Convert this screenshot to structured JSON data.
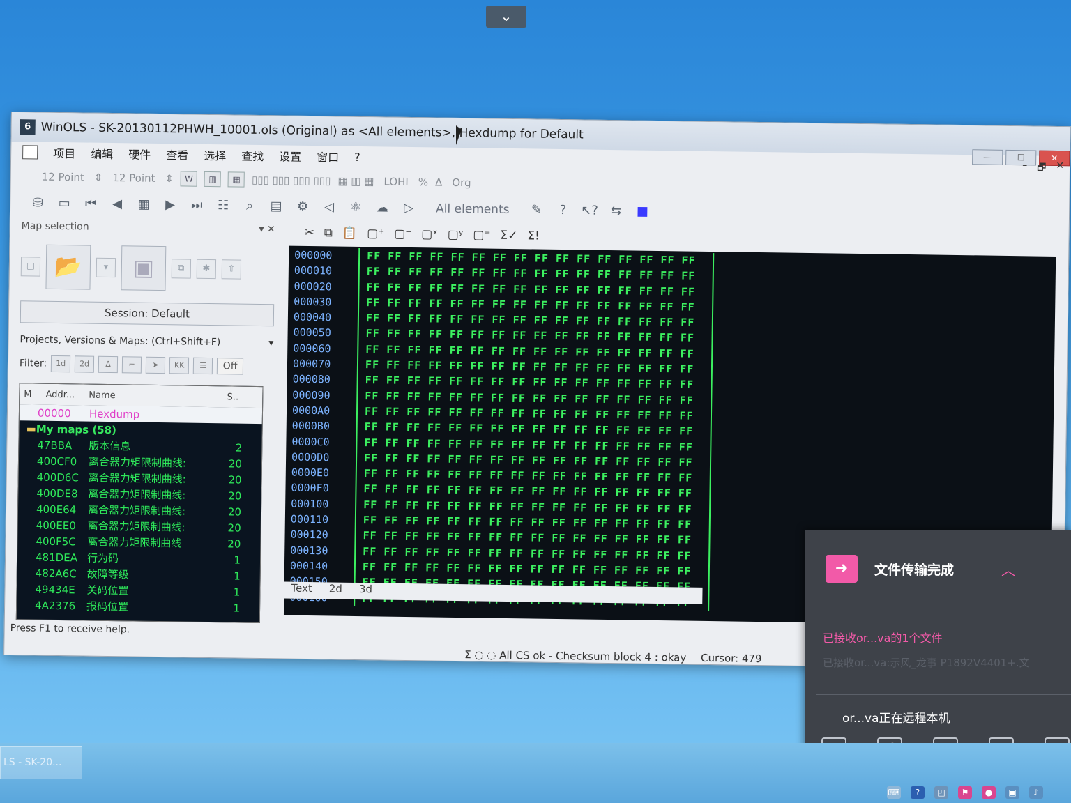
{
  "desktop": {
    "collapse_glyph": "⌄"
  },
  "window": {
    "app_icon_glyph": "6",
    "title": "WinOLS - SK-20130112PHWH_10001.ols (Original) as <All elements>, Hexdump for Default",
    "controls": {
      "minimize": "—",
      "maximize": "☐",
      "close": "✕"
    }
  },
  "menu": {
    "items": [
      "项目",
      "编辑",
      "硬件",
      "查看",
      "选择",
      "查找",
      "设置",
      "窗口",
      "?"
    ]
  },
  "mdi_controls": {
    "minimize": "–",
    "restore": "🗗",
    "close": "✕"
  },
  "toolbar1": {
    "font1": "12 Point",
    "font2": "12 Point",
    "lohi": "LOHI",
    "org": "Org"
  },
  "toolbar2": {
    "elements_label": "All elements"
  },
  "panel": {
    "header": "Map selection",
    "session": "Session: Default",
    "projects_label": "Projects, Versions & Maps:  (Ctrl+Shift+F)",
    "filter_label": "Filter:",
    "off_label": "Off",
    "columns": {
      "m": "M",
      "addr": "Addr...",
      "name": "Name",
      "size": "S.."
    },
    "hexdump_row": {
      "addr": "00000",
      "name": "Hexdump"
    },
    "group_label": "My maps (58)",
    "rows": [
      {
        "addr": "47BBA",
        "name": "版本信息",
        "size": "2"
      },
      {
        "addr": "400CF0",
        "name": "离合器力矩限制曲线:",
        "size": "20"
      },
      {
        "addr": "400D6C",
        "name": "离合器力矩限制曲线:",
        "size": "20"
      },
      {
        "addr": "400DE8",
        "name": "离合器力矩限制曲线:",
        "size": "20"
      },
      {
        "addr": "400E64",
        "name": "离合器力矩限制曲线:",
        "size": "20"
      },
      {
        "addr": "400EE0",
        "name": "离合器力矩限制曲线:",
        "size": "20"
      },
      {
        "addr": "400F5C",
        "name": "离合器力矩限制曲线",
        "size": "20"
      },
      {
        "addr": "481DEA",
        "name": "行为码",
        "size": "1"
      },
      {
        "addr": "482A6C",
        "name": "故障等级",
        "size": "1"
      },
      {
        "addr": "49434E",
        "name": "关码位置",
        "size": "1"
      },
      {
        "addr": "4A2376",
        "name": "报码位置",
        "size": "1"
      }
    ]
  },
  "hex": {
    "offsets": [
      "000000",
      "000010",
      "000020",
      "000030",
      "000040",
      "000050",
      "000060",
      "000070",
      "000080",
      "000090",
      "0000A0",
      "0000B0",
      "0000C0",
      "0000D0",
      "0000E0",
      "0000F0",
      "000100",
      "000110",
      "000120",
      "000130",
      "000140",
      "000150",
      "000160"
    ],
    "line": "FF FF FF FF FF FF FF FF FF FF FF FF FF FF FF FF",
    "tabs": [
      "Text",
      "2d",
      "3d"
    ]
  },
  "status": {
    "help": "Press F1 to receive help.",
    "checksum": "All CS ok - Checksum block 4 : okay",
    "cursor": "Cursor: 479"
  },
  "notification": {
    "title": "文件传输完成",
    "received": "已接收or...va的1个文件",
    "received_detail": "已接收or...va:示风_龙事    P1892V4401+.文",
    "remote": "or...va正在远程本机"
  },
  "taskbar": {
    "task_label": "LS - SK-20..."
  }
}
